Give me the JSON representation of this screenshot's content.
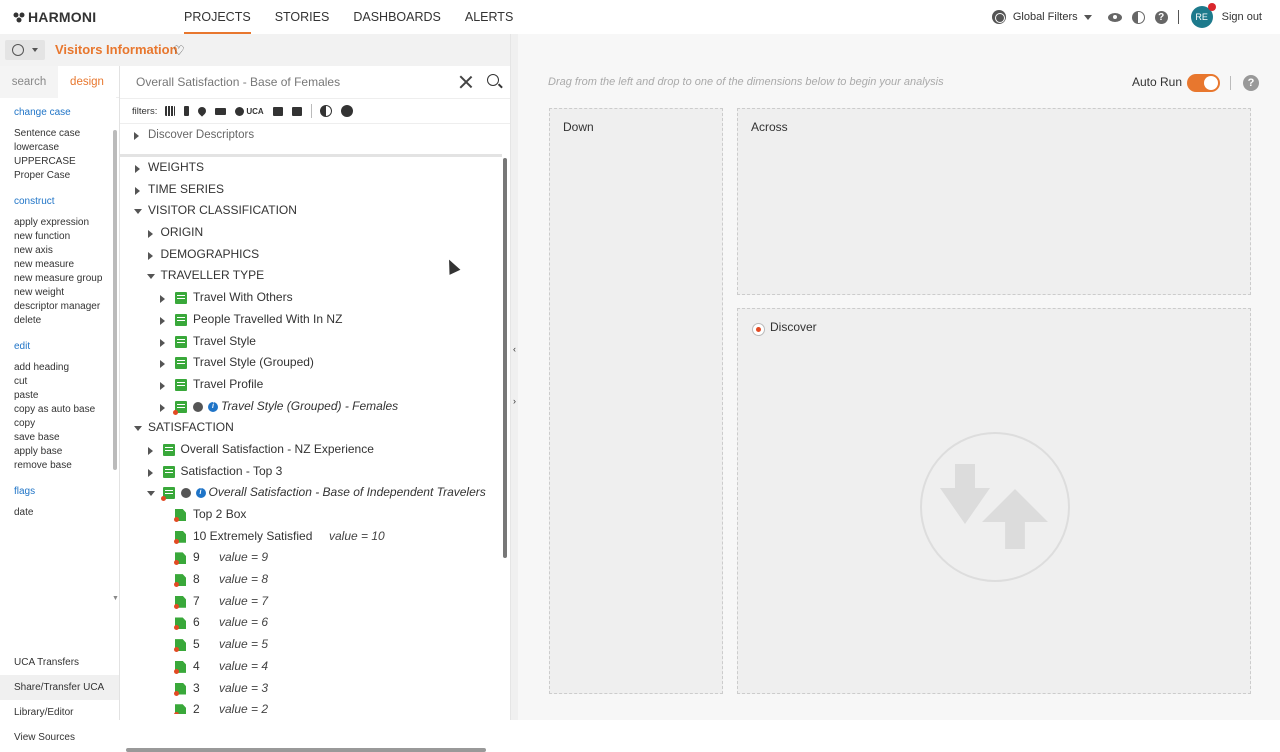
{
  "app": {
    "logo": "HARMONI"
  },
  "nav": {
    "items": [
      "PROJECTS",
      "STORIES",
      "DASHBOARDS",
      "ALERTS"
    ]
  },
  "top_right": {
    "global_filters": "Global Filters",
    "avatar_initials": "RE",
    "sign_out": "Sign out"
  },
  "view": {
    "title": "Visitors Information"
  },
  "sidebar": {
    "tabs": [
      "search",
      "design"
    ],
    "groups": [
      {
        "head": "change case",
        "items": [
          "Sentence case",
          "lowercase",
          "UPPERCASE",
          "Proper Case"
        ]
      },
      {
        "head": "construct",
        "items": [
          "apply expression",
          "new function",
          "new axis",
          "new measure",
          "new measure group",
          "new weight",
          "descriptor manager",
          "delete"
        ]
      },
      {
        "head": "edit",
        "items": [
          "add heading",
          "cut",
          "paste",
          "copy as auto base",
          "copy",
          "save base",
          "apply base",
          "remove base"
        ]
      },
      {
        "head": "flags",
        "items": [
          "date"
        ]
      }
    ],
    "footer": [
      "UCA Transfers",
      "Share/Transfer UCA",
      "Library/Editor",
      "View Sources"
    ]
  },
  "search": {
    "value": "Overall Satisfaction - Base of Females"
  },
  "filters": {
    "label": "filters:",
    "uca_label": "UCA"
  },
  "discover_descriptors": "Discover Descriptors",
  "tree": [
    {
      "label": "WEIGHTS"
    },
    {
      "label": "TIME SERIES"
    },
    {
      "label": "VISITOR CLASSIFICATION"
    },
    {
      "label": "ORIGIN"
    },
    {
      "label": "DEMOGRAPHICS"
    },
    {
      "label": "TRAVELLER TYPE"
    },
    {
      "label": "Travel With Others"
    },
    {
      "label": "People Travelled With In NZ"
    },
    {
      "label": "Travel Style"
    },
    {
      "label": "Travel Style (Grouped)"
    },
    {
      "label": "Travel Profile"
    },
    {
      "label": "Travel Style (Grouped) - Females"
    },
    {
      "label": "SATISFACTION"
    },
    {
      "label": "Overall Satisfaction - NZ Experience"
    },
    {
      "label": "Satisfaction - Top 3"
    },
    {
      "label": "Overall Satisfaction - Base of Independent Travelers"
    },
    {
      "label": "Top 2 Box"
    },
    {
      "label": "10 Extremely Satisfied",
      "value": "value = 10"
    },
    {
      "label": "9",
      "value": "value = 9"
    },
    {
      "label": "8",
      "value": "value = 8"
    },
    {
      "label": "7",
      "value": "value = 7"
    },
    {
      "label": "6",
      "value": "value = 6"
    },
    {
      "label": "5",
      "value": "value = 5"
    },
    {
      "label": "4",
      "value": "value = 4"
    },
    {
      "label": "3",
      "value": "value = 3"
    },
    {
      "label": "2",
      "value": "value = 2"
    }
  ],
  "right": {
    "hint": "Drag from the left and drop to one of the dimensions below to begin your analysis",
    "auto_run": "Auto Run",
    "auto_run_on": true,
    "down": "Down",
    "across": "Across",
    "discover": "Discover"
  },
  "colors": {
    "accent": "#e8772e",
    "link": "#1f74c7",
    "green": "#39a83a"
  }
}
